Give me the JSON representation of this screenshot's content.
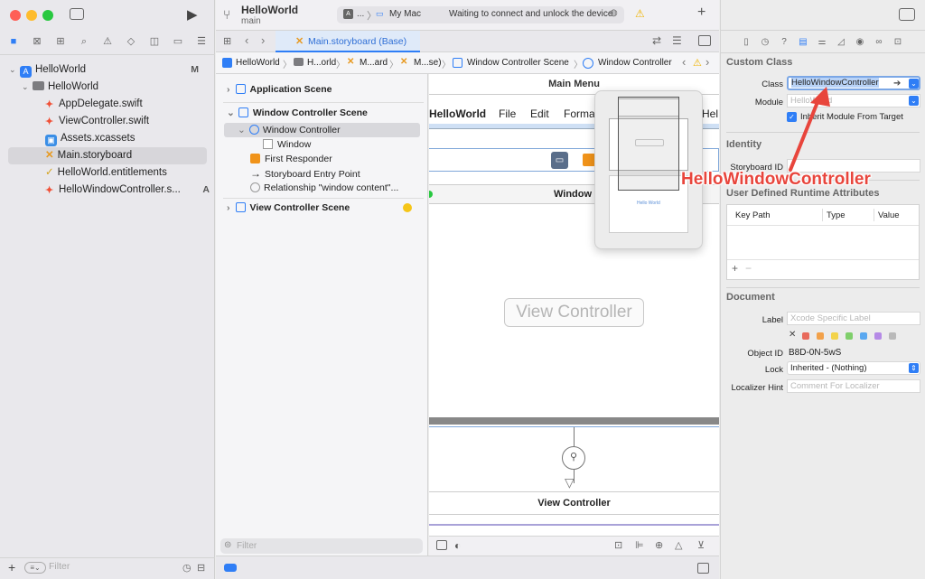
{
  "toolbar": {
    "project_name": "HelloWorld",
    "branch": "main",
    "scheme_prefix": "...",
    "destination": "My Mac",
    "status_message": "Waiting to connect and unlock the device",
    "add_label": "+"
  },
  "navigator": {
    "items": [
      {
        "label": "HelloWorld",
        "badge": "M"
      },
      {
        "label": "HelloWorld",
        "badge": ""
      },
      {
        "label": "AppDelegate.swift",
        "badge": ""
      },
      {
        "label": "ViewController.swift",
        "badge": ""
      },
      {
        "label": "Assets.xcassets",
        "badge": ""
      },
      {
        "label": "Main.storyboard",
        "badge": ""
      },
      {
        "label": "HelloWorld.entitlements",
        "badge": ""
      },
      {
        "label": "HelloWindowController.s...",
        "badge": "A"
      }
    ],
    "filter_placeholder": "Filter"
  },
  "editor": {
    "tab_label": "Main.storyboard (Base)",
    "jumpbar": [
      "HelloWorld",
      "H...orld",
      "M...ard",
      "M...se)",
      "Window Controller Scene",
      "Window Controller"
    ]
  },
  "outline": {
    "items": [
      {
        "label": "Application Scene"
      },
      {
        "label": "Window Controller Scene"
      },
      {
        "label": "Window Controller"
      },
      {
        "label": "Window"
      },
      {
        "label": "First Responder"
      },
      {
        "label": "Storyboard Entry Point"
      },
      {
        "label": "Relationship \"window content\"..."
      },
      {
        "label": "View Controller Scene"
      }
    ],
    "filter_placeholder": "Filter"
  },
  "canvas": {
    "main_menu_title": "Main Menu",
    "menu_items": [
      "HelloWorld",
      "File",
      "Edit",
      "Forma",
      "Hel"
    ],
    "window_title": "Window",
    "view_controller_label": "View Controller",
    "view_controller_scene_title": "View Controller",
    "minimap_label": "Hello World"
  },
  "inspector": {
    "custom_class_header": "Custom Class",
    "class_label": "Class",
    "class_value": "HelloWindowController",
    "module_label": "Module",
    "module_placeholder": "HelloWorld",
    "inherit_label": "Inherit Module From Target",
    "identity_header": "Identity",
    "storyboard_id_label": "Storyboard ID",
    "udra_header": "User Defined Runtime Attributes",
    "udra_columns": [
      "Key Path",
      "Type",
      "Value"
    ],
    "document_header": "Document",
    "label_label": "Label",
    "label_placeholder": "Xcode Specific Label",
    "object_id_label": "Object ID",
    "object_id_value": "B8D-0N-5wS",
    "lock_label": "Lock",
    "lock_value": "Inherited - (Nothing)",
    "localizer_label": "Localizer Hint",
    "localizer_placeholder": "Comment For Localizer"
  },
  "annotation": {
    "text": "HelloWindowController",
    "color": "#e8453c"
  },
  "colors": {
    "accent": "#2f7ef6",
    "selection": "#d7d6da",
    "swatches": [
      "#e86a5c",
      "#f2a14a",
      "#f3d34a",
      "#7fcf6b",
      "#5aa8f0",
      "#b58ae6",
      "#b9b9b9"
    ]
  }
}
